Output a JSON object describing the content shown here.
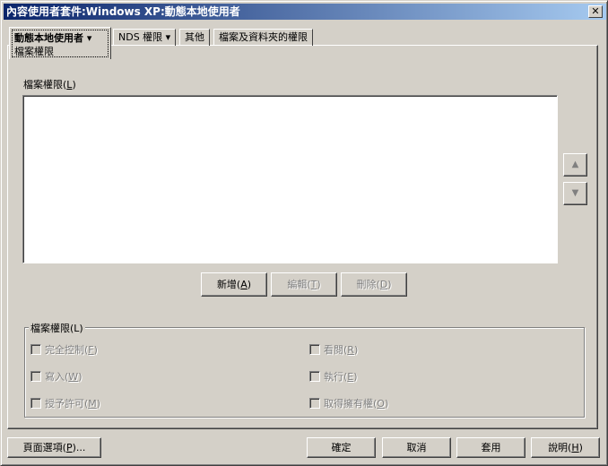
{
  "window": {
    "title": "內容使用者套件:Windows XP:動態本地使用者",
    "close": "✕"
  },
  "tabs": [
    {
      "label": "動態本地使用者 ▾",
      "sub": "檔案權限"
    },
    {
      "label": "NDS 權限 ▾"
    },
    {
      "label": "其他"
    },
    {
      "label": "檔案及資料夾的權限"
    }
  ],
  "list_label": {
    "text": "檔案權限(",
    "key": "L",
    "end": ")"
  },
  "move_up": "▲",
  "move_down": "▼",
  "actions": [
    {
      "text": "新增(",
      "key": "A",
      "end": ")"
    },
    {
      "text": "編輯(",
      "key": "T",
      "end": ")"
    },
    {
      "text": "刪除(",
      "key": "D",
      "end": ")"
    }
  ],
  "group": {
    "legend": "檔案權限(L)",
    "checks": [
      {
        "text": "完全控制(",
        "key": "F",
        "end": ")",
        "checked": false
      },
      {
        "text": "看閱(",
        "key": "R",
        "end": ")",
        "checked": false
      },
      {
        "text": "寫入(",
        "key": "W",
        "end": ")",
        "checked": false
      },
      {
        "text": "執行(",
        "key": "E",
        "end": ")",
        "checked": false
      },
      {
        "text": "授予許可(",
        "key": "M",
        "end": ")",
        "checked": false
      },
      {
        "text": "取得擁有權(",
        "key": "O",
        "end": ")",
        "checked": false
      }
    ]
  },
  "footer": {
    "page_options": {
      "text": "頁面選項(",
      "key": "P",
      "end": ")..."
    },
    "ok": "確定",
    "cancel": "取消",
    "apply": "套用",
    "help": {
      "text": "說明(",
      "key": "H",
      "end": ")"
    }
  }
}
